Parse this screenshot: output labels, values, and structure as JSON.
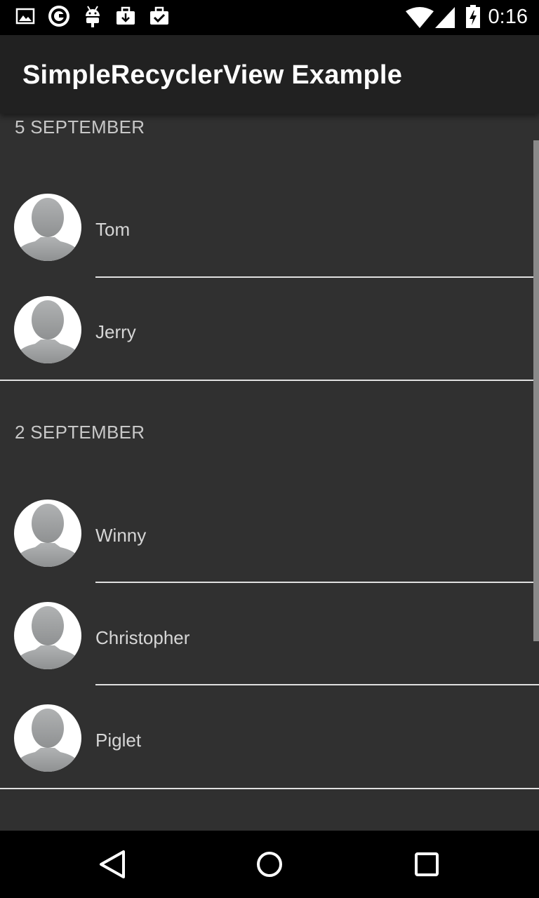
{
  "status_bar": {
    "time": "0:16",
    "left_icons": [
      "image-icon",
      "circle-app-icon",
      "android-debug-icon",
      "briefcase-download-icon",
      "briefcase-check-icon"
    ],
    "right_icons": [
      "wifi-icon",
      "cell-signal-icon",
      "battery-charging-icon"
    ]
  },
  "app_bar": {
    "title": "SimpleRecyclerView Example"
  },
  "sections": [
    {
      "header": "5 SEPTEMBER",
      "items": [
        {
          "name": "Tom"
        },
        {
          "name": "Jerry"
        }
      ]
    },
    {
      "header": "2 SEPTEMBER",
      "items": [
        {
          "name": "Winny"
        },
        {
          "name": "Christopher"
        },
        {
          "name": "Piglet"
        }
      ]
    }
  ],
  "nav_bar": {
    "buttons": [
      "back-icon",
      "home-icon",
      "recents-icon"
    ]
  },
  "colors": {
    "background": "#303030",
    "app_bar": "#212121",
    "status_bar": "#000000",
    "divider": "#e0e0e0",
    "text": "#d6d6d6"
  }
}
